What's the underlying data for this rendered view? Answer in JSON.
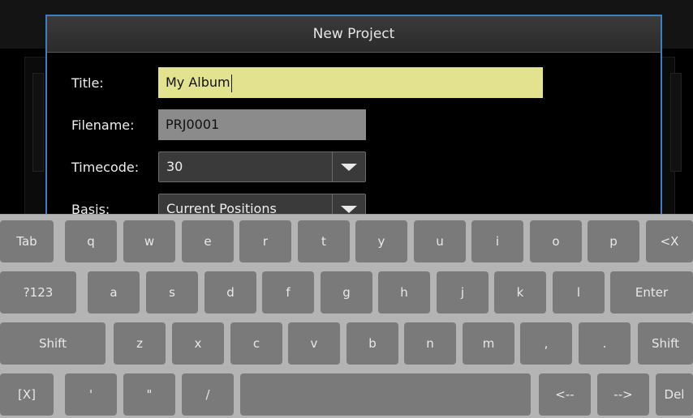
{
  "dialog": {
    "title": "New Project",
    "fields": {
      "title": {
        "label": "Title:",
        "value": "My Album"
      },
      "filename": {
        "label": "Filename:",
        "value": "PRJ0001"
      },
      "timecode": {
        "label": "Timecode:",
        "value": "30"
      },
      "basis": {
        "label": "Basis:",
        "value": "Current Positions"
      }
    }
  },
  "keyboard": {
    "row1": [
      "Tab",
      "q",
      "w",
      "e",
      "r",
      "t",
      "y",
      "u",
      "i",
      "o",
      "p",
      "<X"
    ],
    "row2": [
      "?123",
      "a",
      "s",
      "d",
      "f",
      "g",
      "h",
      "j",
      "k",
      "l",
      "Enter"
    ],
    "row3": [
      "Shift",
      "z",
      "x",
      "c",
      "v",
      "b",
      "n",
      "m",
      ",",
      ".",
      "Shift"
    ],
    "row4": [
      "[X]",
      "'",
      "\"",
      "/",
      "",
      "<--",
      "-->",
      "Del"
    ]
  },
  "colors": {
    "dialog_border": "#3e7fc2",
    "title_field": "#e3e28e",
    "key": "#7a7a7a",
    "keyboard_bg": "#b4b4b4"
  }
}
